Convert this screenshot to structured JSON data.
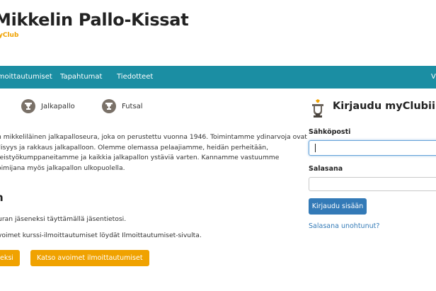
{
  "header": {
    "title": "Mikkelin Pallo-Kissat",
    "tagline": "yClub"
  },
  "nav": {
    "items": [
      "lmoittautumiset",
      "Tapahtumat",
      "Tiedotteet",
      "V"
    ]
  },
  "sports": [
    {
      "label": "Jalkapallo",
      "icon": "trophy-icon"
    },
    {
      "label": "Futsal",
      "icon": "trophy-icon"
    }
  ],
  "intro": {
    "lines": [
      "n mikkeliläinen jalkapalloseura, joka on perustettu vuonna 1946. Toimintamme ydinarvoja ovat",
      "llisyys ja rakkaus jalkapalloon. Olemme olemassa pelaajiamme, heidän perheitään,",
      "teistyökumppaneitamme ja kaikkia jalkapallon ystäviä varten. Kannamme vastuumme",
      "oimijana myös jalkapallon ulkopuolella."
    ]
  },
  "membership": {
    "heading": "n",
    "para1": "uran jäseneksi täyttämällä jäsentietosi.",
    "para2": "voimet kurssi-ilmoittautumiset löydät Ilmoittautumiset-sivulta.",
    "join_button": "eksi",
    "open_registrations_button": "Katso avoimet ilmoittautumiset"
  },
  "login": {
    "title": "Kirjaudu myClubiin",
    "email_label": "Sähköposti",
    "email_value": "",
    "password_label": "Salasana",
    "password_value": "",
    "submit_label": "Kirjaudu sisään",
    "forgot_label": "Salasana unohtunut?"
  },
  "colors": {
    "nav_bg": "#1b8ea3",
    "accent_orange": "#f0a200",
    "primary_blue": "#337ab7"
  }
}
